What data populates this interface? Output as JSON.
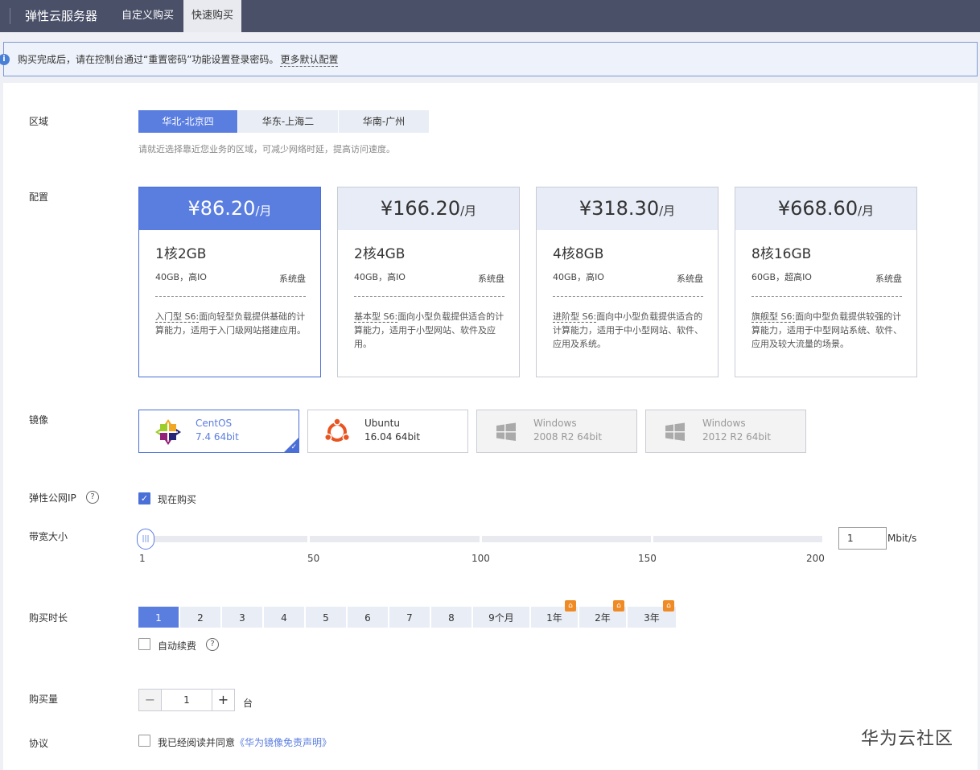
{
  "topbar": {
    "app_title": "弹性云服务器",
    "tabs": [
      {
        "label": "自定义购买",
        "active": false
      },
      {
        "label": "快速购买",
        "active": true
      }
    ]
  },
  "info": {
    "text": "购买完成后，请在控制台通过“重置密码”功能设置登录密码。",
    "more_link": "更多默认配置"
  },
  "labels": {
    "region": "区域",
    "config": "配置",
    "image": "镜像",
    "eip": "弹性公网IP",
    "bandwidth": "带宽大小",
    "duration": "购买时长",
    "quantity": "购买量",
    "agreement": "协议"
  },
  "region": {
    "options": [
      "华北-北京四",
      "华东-上海二",
      "华南-广州"
    ],
    "selected": "华北-北京四",
    "hint": "请就近选择靠近您业务的区域，可减少网络时延，提高访问速度。"
  },
  "configs": [
    {
      "price": "¥86.20",
      "unit": "/月",
      "spec": "1核2GB",
      "disk": "40GB，高IO",
      "disk_type": "系统盘",
      "tag": "入门型 S6:",
      "desc": "面向轻型负载提供基础的计算能力，适用于入门级网站搭建应用。",
      "selected": true
    },
    {
      "price": "¥166.20",
      "unit": "/月",
      "spec": "2核4GB",
      "disk": "40GB，高IO",
      "disk_type": "系统盘",
      "tag": "基本型 S6:",
      "desc": "面向小型负载提供适合的计算能力，适用于小型网站、软件及应用。",
      "selected": false
    },
    {
      "price": "¥318.30",
      "unit": "/月",
      "spec": "4核8GB",
      "disk": "40GB，高IO",
      "disk_type": "系统盘",
      "tag": "进阶型 S6:",
      "desc": "面向中小型负载提供适合的计算能力，适用于中小型网站、软件、应用及系统。",
      "selected": false
    },
    {
      "price": "¥668.60",
      "unit": "/月",
      "spec": "8核16GB",
      "disk": "60GB，超高IO",
      "disk_type": "系统盘",
      "tag": "旗舰型 S6:",
      "desc": "面向中型负载提供较强的计算能力，适用于中型网站系统、软件、应用及较大流量的场景。",
      "selected": false
    }
  ],
  "images": [
    {
      "name": "CentOS",
      "version": "7.4 64bit",
      "icon": "centos-logo-icon",
      "selected": true,
      "disabled": false
    },
    {
      "name": "Ubuntu",
      "version": "16.04 64bit",
      "icon": "ubuntu-logo-icon",
      "selected": false,
      "disabled": false
    },
    {
      "name": "Windows",
      "version": "2008 R2 64bit",
      "icon": "windows-logo-icon",
      "selected": false,
      "disabled": true
    },
    {
      "name": "Windows",
      "version": "2012 R2 64bit",
      "icon": "windows-logo-icon",
      "selected": false,
      "disabled": true
    }
  ],
  "eip": {
    "checkbox_label": "现在购买",
    "checked": true
  },
  "bandwidth": {
    "value": "1",
    "unit": "Mbit/s",
    "ticks": [
      "1",
      "50",
      "100",
      "150",
      "200"
    ],
    "min": 1,
    "max": 200
  },
  "duration": {
    "options": [
      "1",
      "2",
      "3",
      "4",
      "5",
      "6",
      "7",
      "8",
      "9个月",
      "1年",
      "2年",
      "3年"
    ],
    "selected": "1",
    "auto_renew_label": "自动续费"
  },
  "quantity": {
    "value": "1",
    "unit": "台",
    "minus": "−",
    "plus": "+"
  },
  "agreement": {
    "text": "我已经阅读并同意",
    "link": "《华为镜像免责声明》"
  },
  "watermark": "华为云社区",
  "colors": {
    "accent": "#5a7de0",
    "topbar": "#4a5068",
    "promo": "#f08a24"
  }
}
